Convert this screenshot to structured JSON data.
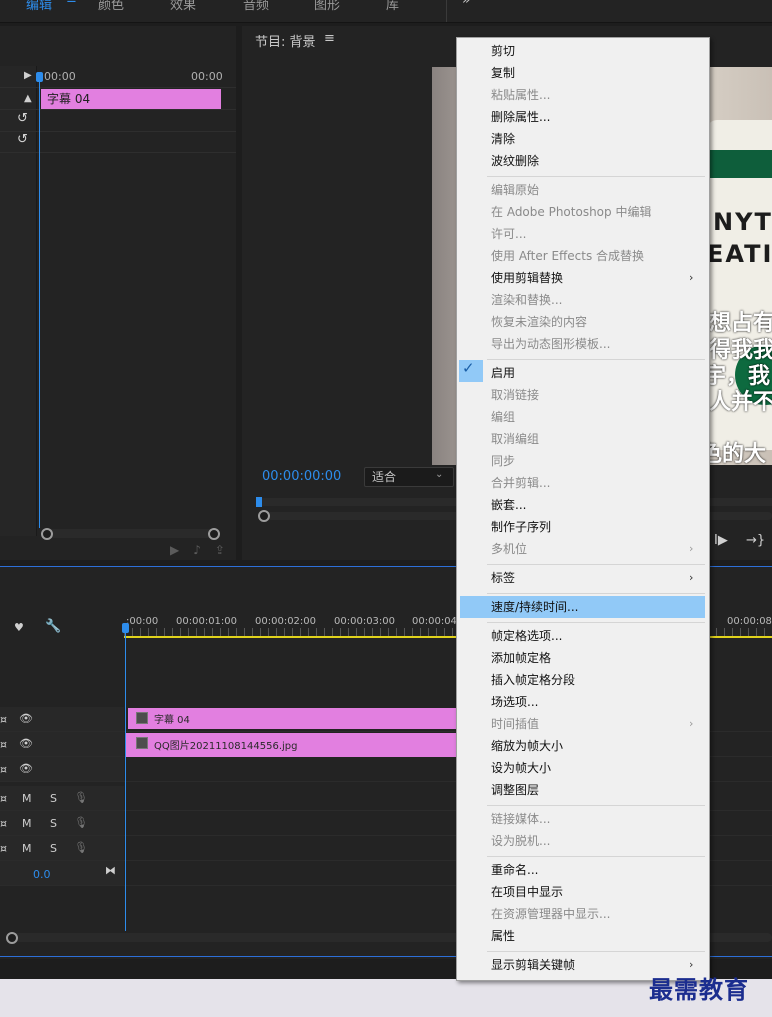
{
  "workspace": {
    "tabs": [
      {
        "label": "编辑",
        "active": true
      },
      {
        "label": "颜色"
      },
      {
        "label": "效果"
      },
      {
        "label": "音频"
      },
      {
        "label": "图形"
      },
      {
        "label": "库"
      }
    ],
    "more": "»"
  },
  "effect_controls": {
    "time_start": "00:00",
    "time_end": "00:00",
    "clip_label": "字幕 04"
  },
  "program_monitor": {
    "title": "节目: 背景",
    "timecode": "00:00:00:00",
    "fit_value": "适合",
    "cup_text_line1": "NYT",
    "cup_text_line2": "EATI",
    "subtitles": [
      "想占有",
      "得我我",
      "宇，我",
      "人并不",
      "色的大"
    ]
  },
  "timeline": {
    "ruler": [
      ":00:00",
      "00:00:01:00",
      "00:00:02:00",
      "00:00:03:00",
      "00:00:04:",
      "00:00:08:"
    ],
    "clips": {
      "v2": "字幕 04",
      "v1": "QQ图片20211108144556.jpg"
    },
    "track_labels": {
      "m": "M",
      "s": "S"
    },
    "master_value": "0.0"
  },
  "context_menu": {
    "items": [
      {
        "label": "剪切"
      },
      {
        "label": "复制"
      },
      {
        "label": "粘贴属性...",
        "disabled": true
      },
      {
        "label": "删除属性..."
      },
      {
        "label": "清除"
      },
      {
        "label": "波纹删除"
      },
      {
        "label": "编辑原始",
        "disabled": true
      },
      {
        "label": "在 Adobe Photoshop 中编辑",
        "disabled": true
      },
      {
        "label": "许可...",
        "disabled": true
      },
      {
        "label": "使用 After Effects 合成替换",
        "disabled": true
      },
      {
        "label": "使用剪辑替换"
      },
      {
        "label": "渲染和替换...",
        "disabled": true
      },
      {
        "label": "恢复未渲染的内容",
        "disabled": true
      },
      {
        "label": "导出为动态图形模板...",
        "disabled": true
      },
      {
        "label": "启用",
        "checked": true
      },
      {
        "label": "取消链接",
        "disabled": true
      },
      {
        "label": "编组",
        "disabled": true
      },
      {
        "label": "取消编组",
        "disabled": true
      },
      {
        "label": "同步",
        "disabled": true
      },
      {
        "label": "合并剪辑...",
        "disabled": true
      },
      {
        "label": "嵌套..."
      },
      {
        "label": "制作子序列"
      },
      {
        "label": "多机位",
        "disabled": true
      },
      {
        "label": "标签"
      },
      {
        "label": "速度/持续时间...",
        "highlighted": true
      },
      {
        "label": "帧定格选项..."
      },
      {
        "label": "添加帧定格"
      },
      {
        "label": "插入帧定格分段"
      },
      {
        "label": "场选项..."
      },
      {
        "label": "时间插值",
        "disabled": true
      },
      {
        "label": "缩放为帧大小"
      },
      {
        "label": "设为帧大小"
      },
      {
        "label": "调整图层"
      },
      {
        "label": "链接媒体...",
        "disabled": true
      },
      {
        "label": "设为脱机...",
        "disabled": true
      },
      {
        "label": "重命名..."
      },
      {
        "label": "在项目中显示"
      },
      {
        "label": "在资源管理器中显示...",
        "disabled": true
      },
      {
        "label": "属性"
      },
      {
        "label": "显示剪辑关键帧"
      }
    ],
    "submenu_arrow": "›",
    "check_mark": "✓"
  },
  "watermark": "最需教育",
  "colors": {
    "accent": "#2d8ceb",
    "clip": "#e27fe0",
    "menu_highlight": "#91c9f7"
  }
}
